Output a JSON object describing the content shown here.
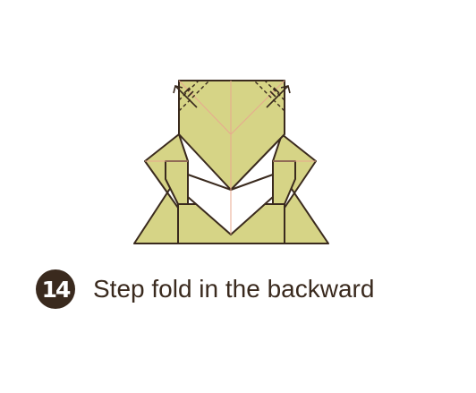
{
  "step": {
    "number": "14",
    "instruction": "Step fold in the backward"
  },
  "colors": {
    "paper": "#d6d486",
    "paper_back": "#ffffff",
    "outline": "#3a2a1e",
    "crease": "#e8a98f",
    "badge": "#3a2a1e"
  },
  "icons": {
    "left_corner": "step-fold-arrow-icon",
    "right_corner": "step-fold-arrow-icon"
  }
}
